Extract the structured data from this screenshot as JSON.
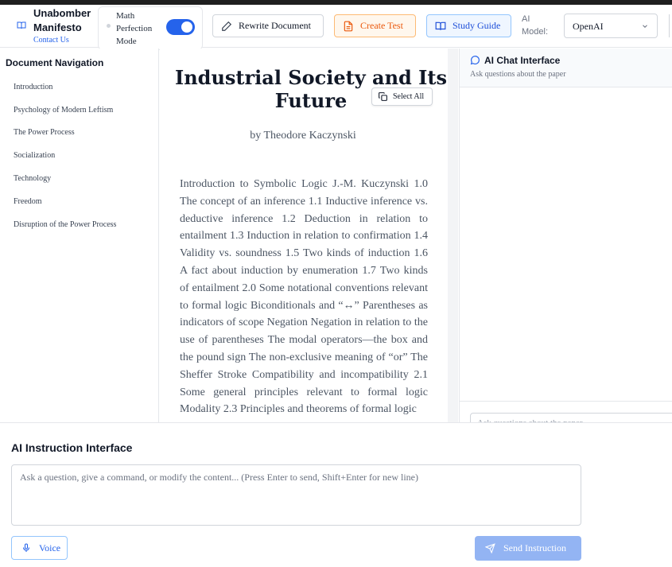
{
  "header": {
    "brand_title": "Unabomber Manifesto",
    "contact_link": "Contact Us",
    "math_perfection_label": "Math Perfection Mode",
    "math_perfection_enabled": true,
    "rewrite_label": "Rewrite Document",
    "create_test_label": "Create Test",
    "study_guide_label": "Study Guide",
    "ai_model_label": "AI Model:",
    "ai_model_value": "OpenAI"
  },
  "sidebar": {
    "title": "Document Navigation",
    "items": [
      {
        "label": "Introduction"
      },
      {
        "label": "Psychology of Modern Leftism"
      },
      {
        "label": "The Power Process"
      },
      {
        "label": "Socialization"
      },
      {
        "label": "Technology"
      },
      {
        "label": "Freedom"
      },
      {
        "label": "Disruption of the Power Process"
      }
    ]
  },
  "document": {
    "title": "Industrial Society and Its Future",
    "select_all_label": "Select All",
    "author": "by Theodore Kaczynski",
    "body": "Introduction to Symbolic Logic J.-M. Kuczynski 1.0 The concept of an inference 1.1 Inductive inference vs. deductive inference 1.2 Deduction in relation to entailment 1.3 Induction in relation to confirmation 1.4 Validity vs. soundness 1.5 Two kinds of induction 1.6 A fact about induction by enumeration 1.7 Two kinds of entailment 2.0 Some notational conventions relevant to formal logic Biconditionals and “↔” Parentheses as indicators of scope Negation Negation in relation to the use of parentheses The modal operators—the box and the pound sign The non-exclusive meaning of “or” The Sheffer Stroke Compatibility and incompatibility 2.1 Some general principles relevant to formal logic Modality 2.3 Principles and theorems of formal logic"
  },
  "chat": {
    "title": "AI Chat Interface",
    "subtitle": "Ask questions about the paper",
    "input_placeholder": "Ask questions about the paper..."
  },
  "instruction": {
    "title": "AI Instruction Interface",
    "input_placeholder": "Ask a question, give a command, or modify the content... (Press Enter to send, Shift+Enter for new line)",
    "voice_label": "Voice",
    "send_label": "Send Instruction"
  },
  "colors": {
    "accent": "#2563eb",
    "create_test": "#ea580c",
    "send_disabled": "#93b4f3"
  }
}
